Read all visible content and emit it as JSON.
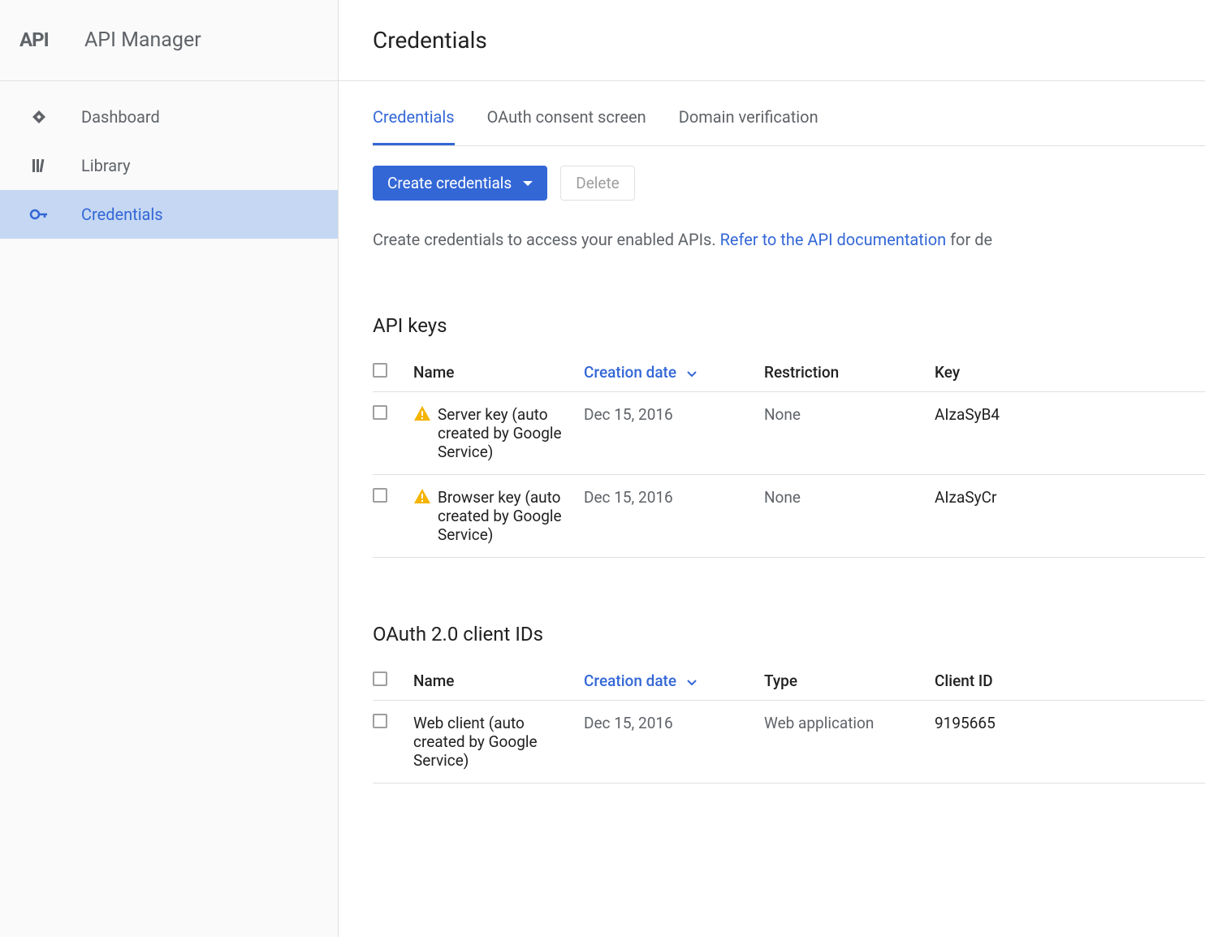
{
  "header": {
    "app_title": "API Manager"
  },
  "sidebar": {
    "items": [
      {
        "label": "Dashboard",
        "icon": "dashboard-icon"
      },
      {
        "label": "Library",
        "icon": "library-icon"
      },
      {
        "label": "Credentials",
        "icon": "key-icon"
      }
    ]
  },
  "main": {
    "title": "Credentials",
    "tabs": [
      {
        "label": "Credentials"
      },
      {
        "label": "OAuth consent screen"
      },
      {
        "label": "Domain verification"
      }
    ],
    "actions": {
      "create_label": "Create credentials",
      "delete_label": "Delete"
    },
    "description": {
      "prefix": "Create credentials to access your enabled APIs. ",
      "link": "Refer to the API documentation",
      "suffix": " for de"
    },
    "api_keys_section": {
      "title": "API keys",
      "columns": {
        "name": "Name",
        "creation_date": "Creation date",
        "restriction": "Restriction",
        "key": "Key"
      },
      "rows": [
        {
          "name": "Server key (auto created by Google Service)",
          "date": "Dec 15, 2016",
          "restriction": "None",
          "key": "AIzaSyB4"
        },
        {
          "name": "Browser key (auto created by Google Service)",
          "date": "Dec 15, 2016",
          "restriction": "None",
          "key": "AIzaSyCr"
        }
      ]
    },
    "oauth_section": {
      "title": "OAuth 2.0 client IDs",
      "columns": {
        "name": "Name",
        "creation_date": "Creation date",
        "type": "Type",
        "client_id": "Client ID"
      },
      "rows": [
        {
          "name": "Web client (auto created by Google Service)",
          "date": "Dec 15, 2016",
          "type": "Web application",
          "client_id": "9195665"
        }
      ]
    }
  }
}
